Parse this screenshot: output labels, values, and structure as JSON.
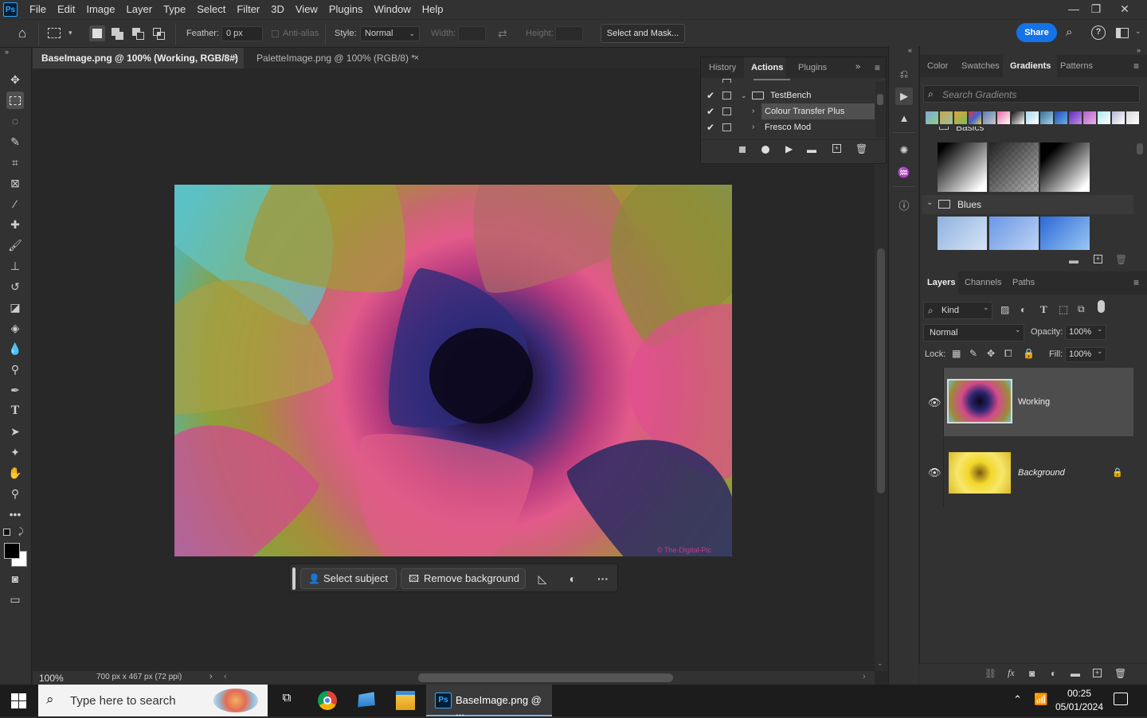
{
  "menubar": {
    "logo": "Ps",
    "items": [
      "File",
      "Edit",
      "Image",
      "Layer",
      "Type",
      "Select",
      "Filter",
      "3D",
      "View",
      "Plugins",
      "Window",
      "Help"
    ]
  },
  "options": {
    "feather_label": "Feather:",
    "feather_value": "0 px",
    "antialias_label": "Anti-alias",
    "style_label": "Style:",
    "style_value": "Normal",
    "width_label": "Width:",
    "height_label": "Height:",
    "select_mask_label": "Select and Mask...",
    "share_label": "Share"
  },
  "tabs": [
    {
      "label": "BaseImage.png @ 100% (Working, RGB/8#) *",
      "active": true
    },
    {
      "label": "PaletteImage.png @ 100% (RGB/8) *",
      "active": false
    }
  ],
  "tab_close": "×",
  "actions_panel": {
    "tabs": [
      "History",
      "Actions",
      "Plugins"
    ],
    "active_tab": "Actions",
    "rows": [
      {
        "label": "TestBench",
        "kind": "set"
      },
      {
        "label": "Colour Transfer Plus",
        "kind": "action",
        "selected": true
      },
      {
        "label": "Fresco Mod",
        "kind": "action"
      }
    ]
  },
  "color_panel": {
    "tabs": [
      "Color",
      "Swatches",
      "Gradients",
      "Patterns"
    ],
    "active_tab": "Gradients",
    "search_placeholder": "Search Gradients",
    "group_basics": "Basics",
    "group_blues": "Blues"
  },
  "layers_panel": {
    "tabs": [
      "Layers",
      "Channels",
      "Paths"
    ],
    "active_tab": "Layers",
    "kind_label": "Kind",
    "blend_mode": "Normal",
    "opacity_label": "Opacity:",
    "opacity_value": "100%",
    "lock_label": "Lock:",
    "fill_label": "Fill:",
    "fill_value": "100%",
    "layers": [
      {
        "name": "Working",
        "selected": true
      },
      {
        "name": "Background",
        "locked": true
      }
    ]
  },
  "context_bar": {
    "select_subject": "Select subject",
    "remove_background": "Remove background",
    "more": "···"
  },
  "status": {
    "zoom": "100%",
    "doc_info": "700 px x 467 px (72 ppi)"
  },
  "watermark": "© The-Digital-Pic",
  "taskbar": {
    "search_placeholder": "Type here to search",
    "ps_task_label": "BaseImage.png @ ...",
    "time": "00:25",
    "date": "05/01/2024"
  },
  "colors": {
    "accent": "#1473e6",
    "panel_bg": "#323232",
    "canvas_bg": "#282828"
  }
}
